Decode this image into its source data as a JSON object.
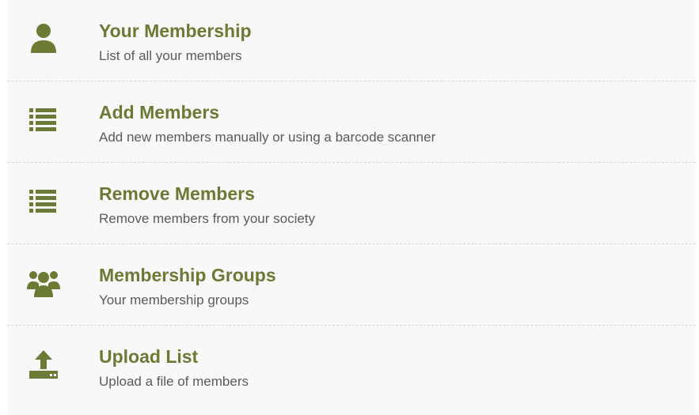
{
  "colors": {
    "accent": "#6b7a34",
    "description": "#5a5a5a",
    "background": "#f8f8f8",
    "divider": "#d6d6d6"
  },
  "menu": {
    "items": [
      {
        "title": "Your Membership",
        "description": "List of all your members",
        "icon": "user-icon"
      },
      {
        "title": "Add Members",
        "description": "Add new members manually or using a barcode scanner",
        "icon": "list-icon"
      },
      {
        "title": "Remove Members",
        "description": "Remove members from your society",
        "icon": "list-icon"
      },
      {
        "title": "Membership Groups",
        "description": "Your membership groups",
        "icon": "users-group-icon"
      },
      {
        "title": "Upload List",
        "description": "Upload a file of members",
        "icon": "upload-icon"
      }
    ]
  }
}
